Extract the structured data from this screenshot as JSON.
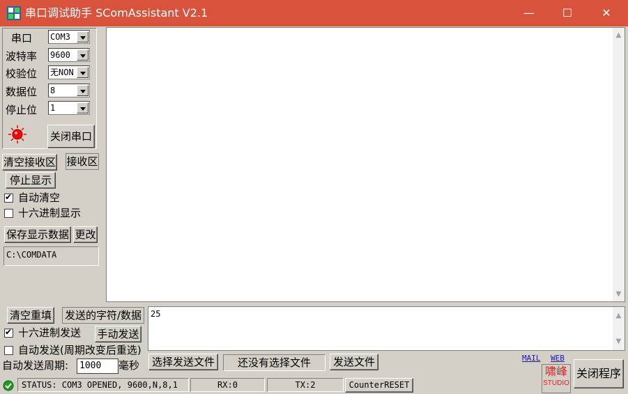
{
  "window": {
    "title": "串口调试助手 SComAssistant V2.1",
    "minimize_glyph": "—",
    "maximize_glyph": "☐",
    "close_glyph": "✕"
  },
  "settings": {
    "port_label": "串口",
    "port_value": "COM3",
    "baud_label": "波特率",
    "baud_value": "9600",
    "parity_label": "校验位",
    "parity_value": "无NON",
    "databits_label": "数据位",
    "databits_value": "8",
    "stopbits_label": "停止位",
    "stopbits_value": "1",
    "close_port_button": "关闭串口"
  },
  "receive": {
    "clear_button": "清空接收区",
    "area_button": "接收区",
    "stop_display_button": "停止显示",
    "auto_clear_label": "自动清空",
    "auto_clear_checked": true,
    "hex_display_label": "十六进制显示",
    "hex_display_checked": false,
    "save_button": "保存显示数据",
    "change_button": "更改",
    "save_path": "C:\\COMDATA",
    "content": ""
  },
  "send": {
    "clear_button": "清空重填",
    "chars_button": "发送的字符/数据",
    "hex_send_label": "十六进制发送",
    "hex_send_checked": true,
    "manual_send_button": "手动发送",
    "auto_send_label": "自动发送(周期改变后重选)",
    "auto_send_checked": false,
    "period_label": "自动发送周期:",
    "period_value": "1000",
    "period_unit": "毫秒",
    "content": "25",
    "select_file_button": "选择发送文件",
    "file_status": "还没有选择文件",
    "send_file_button": "发送文件"
  },
  "links": {
    "mail": "MAIL",
    "web": "WEB"
  },
  "logo": {
    "line1": "啸峰",
    "line2": "STUDIO"
  },
  "close_program_button": "关闭程序",
  "statusbar": {
    "status": "STATUS: COM3 OPENED, 9600,N,8,1",
    "rx": "RX:0",
    "tx": "TX:2",
    "reset": "CounterRESET"
  },
  "colors": {
    "titlebar": "#d9523c",
    "panel": "#d4d0c8",
    "indicator": "#ff0000",
    "link": "#1a1aa6",
    "logo": "#e02020"
  }
}
